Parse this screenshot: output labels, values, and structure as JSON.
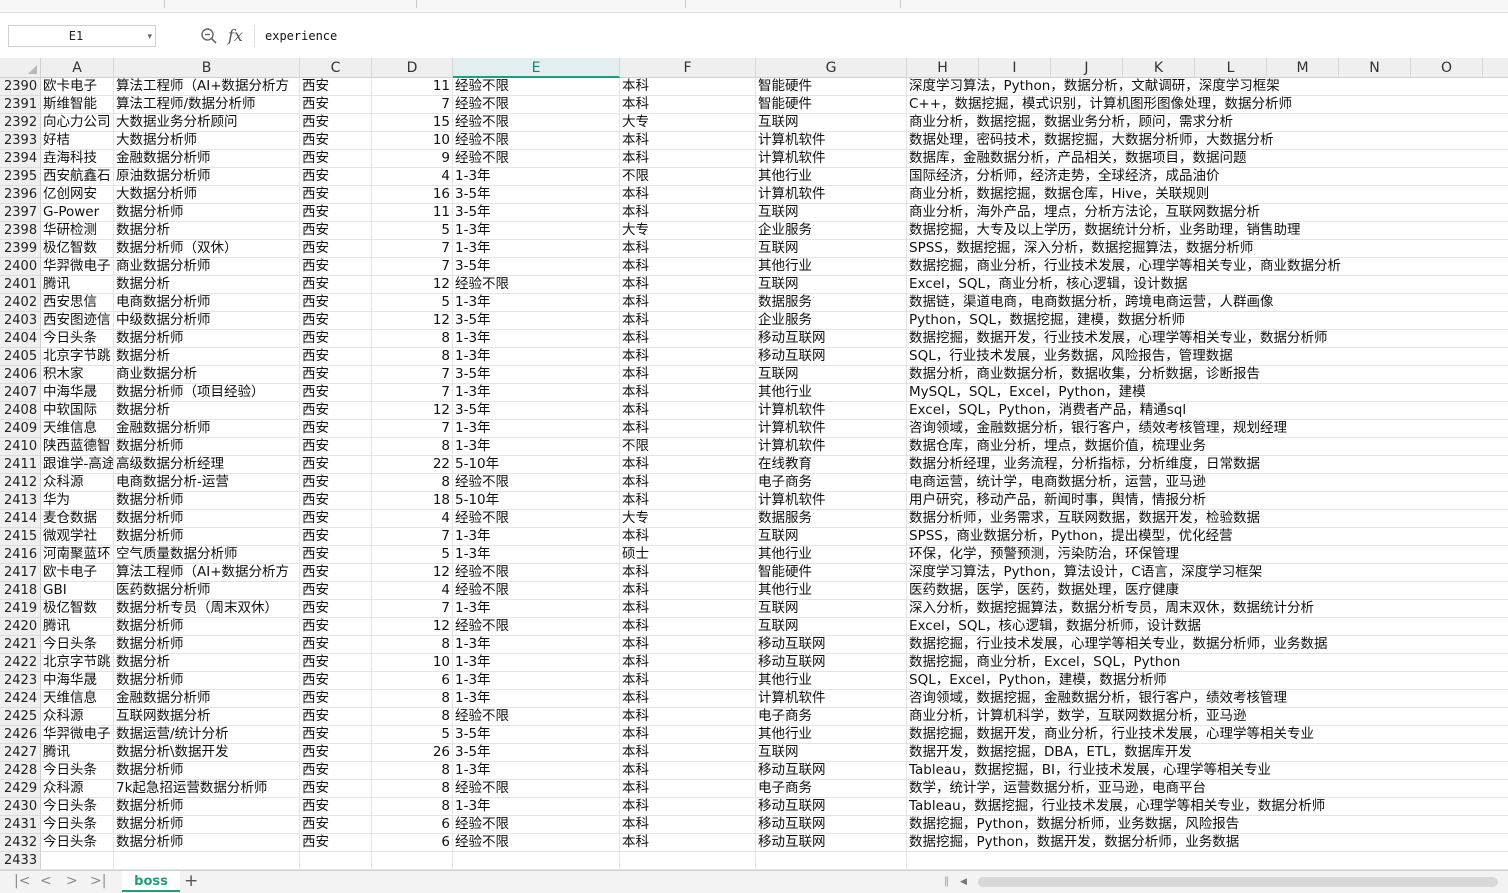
{
  "formula_bar": {
    "name_box": "E1",
    "formula": "experience",
    "fx_label": "fx"
  },
  "columns": [
    "A",
    "B",
    "C",
    "D",
    "E",
    "F",
    "G",
    "H",
    "I",
    "J",
    "K",
    "L",
    "M",
    "N",
    "O"
  ],
  "selected_column": "E",
  "rows": [
    {
      "n": "2390",
      "a": "欧卡电子",
      "b": "算法工程师（AI+数据分析方",
      "c": "西安",
      "d": "11",
      "e": "经验不限",
      "f": "本科",
      "g": "智能硬件",
      "h": "深度学习算法，Python，数据分析，文献调研，深度学习框架"
    },
    {
      "n": "2391",
      "a": "斯维智能",
      "b": "算法工程师/数据分析师",
      "c": "西安",
      "d": "7",
      "e": "经验不限",
      "f": "本科",
      "g": "智能硬件",
      "h": "C++，数据挖掘，模式识别，计算机图形图像处理，数据分析师"
    },
    {
      "n": "2392",
      "a": "向心力公司",
      "b": "大数据业务分析顾问",
      "c": "西安",
      "d": "15",
      "e": "经验不限",
      "f": "大专",
      "g": "互联网",
      "h": "商业分析，数据挖掘，数据业务分析，顾问，需求分析"
    },
    {
      "n": "2393",
      "a": "好桔",
      "b": "大数据分析师",
      "c": "西安",
      "d": "10",
      "e": "经验不限",
      "f": "本科",
      "g": "计算机软件",
      "h": "数据处理，密码技术，数据挖掘，大数据分析师，大数据分析"
    },
    {
      "n": "2394",
      "a": "垚海科技",
      "b": "金融数据分析师",
      "c": "西安",
      "d": "9",
      "e": "经验不限",
      "f": "本科",
      "g": "计算机软件",
      "h": "数据库，金融数据分析，产品相关，数据项目，数据问题"
    },
    {
      "n": "2395",
      "a": "西安航鑫石",
      "b": "原油数据分析师",
      "c": "西安",
      "d": "4",
      "e": "1-3年",
      "f": "不限",
      "g": "其他行业",
      "h": "国际经济，分析师，经济走势，全球经济，成品油价"
    },
    {
      "n": "2396",
      "a": "亿创网安",
      "b": "大数据分析师",
      "c": "西安",
      "d": "16",
      "e": "3-5年",
      "f": "本科",
      "g": "计算机软件",
      "h": "商业分析，数据挖掘，数据仓库，Hive，关联规则"
    },
    {
      "n": "2397",
      "a": "G-Power",
      "b": "数据分析师",
      "c": "西安",
      "d": "11",
      "e": "3-5年",
      "f": "本科",
      "g": "互联网",
      "h": "商业分析，海外产品，埋点，分析方法论，互联网数据分析"
    },
    {
      "n": "2398",
      "a": "华研检测",
      "b": "数据分析",
      "c": "西安",
      "d": "5",
      "e": "1-3年",
      "f": "大专",
      "g": "企业服务",
      "h": "数据挖掘，大专及以上学历，数据统计分析，业务助理，销售助理"
    },
    {
      "n": "2399",
      "a": "极亿智数",
      "b": "数据分析师（双休）",
      "c": "西安",
      "d": "7",
      "e": "1-3年",
      "f": "本科",
      "g": "互联网",
      "h": "SPSS，数据挖掘，深入分析，数据挖掘算法，数据分析师"
    },
    {
      "n": "2400",
      "a": "华羿微电子",
      "b": "商业数据分析师",
      "c": "西安",
      "d": "7",
      "e": "3-5年",
      "f": "本科",
      "g": "其他行业",
      "h": "数据挖掘，商业分析，行业技术发展，心理学等相关专业，商业数据分析"
    },
    {
      "n": "2401",
      "a": "腾讯",
      "b": "数据分析",
      "c": "西安",
      "d": "12",
      "e": "经验不限",
      "f": "本科",
      "g": "互联网",
      "h": "Excel，SQL，商业分析，核心逻辑，设计数据"
    },
    {
      "n": "2402",
      "a": "西安思信",
      "b": "电商数据分析师",
      "c": "西安",
      "d": "5",
      "e": "1-3年",
      "f": "本科",
      "g": "数据服务",
      "h": "数据链，渠道电商，电商数据分析，跨境电商运营，人群画像"
    },
    {
      "n": "2403",
      "a": "西安图迹信",
      "b": "中级数据分析师",
      "c": "西安",
      "d": "12",
      "e": "3-5年",
      "f": "本科",
      "g": "企业服务",
      "h": "Python，SQL，数据挖掘，建模，数据分析师"
    },
    {
      "n": "2404",
      "a": "今日头条",
      "b": "数据分析师",
      "c": "西安",
      "d": "8",
      "e": "1-3年",
      "f": "本科",
      "g": "移动互联网",
      "h": "数据挖掘，数据开发，行业技术发展，心理学等相关专业，数据分析师"
    },
    {
      "n": "2405",
      "a": "北京字节跳",
      "b": "数据分析",
      "c": "西安",
      "d": "8",
      "e": "1-3年",
      "f": "本科",
      "g": "移动互联网",
      "h": "SQL，行业技术发展，业务数据，风险报告，管理数据"
    },
    {
      "n": "2406",
      "a": "积木家",
      "b": "商业数据分析",
      "c": "西安",
      "d": "7",
      "e": "3-5年",
      "f": "本科",
      "g": "互联网",
      "h": "数据分析，商业数据分析，数据收集，分析数据，诊断报告"
    },
    {
      "n": "2407",
      "a": "中海华晟",
      "b": "数据分析师（项目经验）",
      "c": "西安",
      "d": "7",
      "e": "1-3年",
      "f": "本科",
      "g": "其他行业",
      "h": "MySQL，SQL，Excel，Python，建模"
    },
    {
      "n": "2408",
      "a": "中软国际",
      "b": "数据分析",
      "c": "西安",
      "d": "12",
      "e": "3-5年",
      "f": "本科",
      "g": "计算机软件",
      "h": "Excel，SQL，Python，消费者产品，精通sql"
    },
    {
      "n": "2409",
      "a": "天维信息",
      "b": "金融数据分析师",
      "c": "西安",
      "d": "7",
      "e": "1-3年",
      "f": "本科",
      "g": "计算机软件",
      "h": "咨询领域，金融数据分析，银行客户，绩效考核管理，规划经理"
    },
    {
      "n": "2410",
      "a": "陕西蓝德智",
      "b": "数据分析师",
      "c": "西安",
      "d": "8",
      "e": "1-3年",
      "f": "不限",
      "g": "计算机软件",
      "h": "数据仓库，商业分析，埋点，数据价值，梳理业务"
    },
    {
      "n": "2411",
      "a": "跟谁学-高途",
      "b": "高级数据分析经理",
      "c": "西安",
      "d": "22",
      "e": "5-10年",
      "f": "本科",
      "g": "在线教育",
      "h": "数据分析经理，业务流程，分析指标，分析维度，日常数据"
    },
    {
      "n": "2412",
      "a": "众科源",
      "b": "电商数据分析-运营",
      "c": "西安",
      "d": "8",
      "e": "经验不限",
      "f": "本科",
      "g": "电子商务",
      "h": "电商运营，统计学，电商数据分析，运营，亚马逊"
    },
    {
      "n": "2413",
      "a": "华为",
      "b": "数据分析师",
      "c": "西安",
      "d": "18",
      "e": "5-10年",
      "f": "本科",
      "g": "计算机软件",
      "h": "用户研究，移动产品，新闻时事，舆情，情报分析"
    },
    {
      "n": "2414",
      "a": "麦仓数据",
      "b": "数据分析师",
      "c": "西安",
      "d": "4",
      "e": "经验不限",
      "f": "大专",
      "g": "数据服务",
      "h": "数据分析师，业务需求，互联网数据，数据开发，检验数据"
    },
    {
      "n": "2415",
      "a": "微观学社",
      "b": "数据分析师",
      "c": "西安",
      "d": "7",
      "e": "1-3年",
      "f": "本科",
      "g": "互联网",
      "h": "SPSS，商业数据分析，Python，提出模型，优化经营"
    },
    {
      "n": "2416",
      "a": "河南聚蓝环",
      "b": "空气质量数据分析师",
      "c": "西安",
      "d": "5",
      "e": "1-3年",
      "f": "硕士",
      "g": "其他行业",
      "h": "环保，化学，预警预测，污染防治，环保管理"
    },
    {
      "n": "2417",
      "a": "欧卡电子",
      "b": "算法工程师（AI+数据分析方",
      "c": "西安",
      "d": "12",
      "e": "经验不限",
      "f": "本科",
      "g": "智能硬件",
      "h": "深度学习算法，Python，算法设计，C语言，深度学习框架"
    },
    {
      "n": "2418",
      "a": "GBI",
      "b": "医药数据分析师",
      "c": "西安",
      "d": "4",
      "e": "经验不限",
      "f": "本科",
      "g": "其他行业",
      "h": "医药数据，医学，医药，数据处理，医疗健康"
    },
    {
      "n": "2419",
      "a": "极亿智数",
      "b": "数据分析专员（周末双休）",
      "c": "西安",
      "d": "7",
      "e": "1-3年",
      "f": "本科",
      "g": "互联网",
      "h": "深入分析，数据挖掘算法，数据分析专员，周末双休，数据统计分析"
    },
    {
      "n": "2420",
      "a": "腾讯",
      "b": "数据分析师",
      "c": "西安",
      "d": "12",
      "e": "经验不限",
      "f": "本科",
      "g": "互联网",
      "h": "Excel，SQL，核心逻辑，数据分析师，设计数据"
    },
    {
      "n": "2421",
      "a": "今日头条",
      "b": "数据分析师",
      "c": "西安",
      "d": "8",
      "e": "1-3年",
      "f": "本科",
      "g": "移动互联网",
      "h": "数据挖掘，行业技术发展，心理学等相关专业，数据分析师，业务数据"
    },
    {
      "n": "2422",
      "a": "北京字节跳",
      "b": "数据分析",
      "c": "西安",
      "d": "10",
      "e": "1-3年",
      "f": "本科",
      "g": "移动互联网",
      "h": "数据挖掘，商业分析，Excel，SQL，Python"
    },
    {
      "n": "2423",
      "a": "中海华晟",
      "b": "数据分析师",
      "c": "西安",
      "d": "6",
      "e": "1-3年",
      "f": "本科",
      "g": "其他行业",
      "h": "SQL，Excel，Python，建模，数据分析师"
    },
    {
      "n": "2424",
      "a": "天维信息",
      "b": "金融数据分析师",
      "c": "西安",
      "d": "8",
      "e": "1-3年",
      "f": "本科",
      "g": "计算机软件",
      "h": "咨询领域，数据挖掘，金融数据分析，银行客户，绩效考核管理"
    },
    {
      "n": "2425",
      "a": "众科源",
      "b": "互联网数据分析",
      "c": "西安",
      "d": "8",
      "e": "经验不限",
      "f": "本科",
      "g": "电子商务",
      "h": "商业分析，计算机科学，数学，互联网数据分析，亚马逊"
    },
    {
      "n": "2426",
      "a": "华羿微电子",
      "b": "数据运营/统计分析",
      "c": "西安",
      "d": "5",
      "e": "3-5年",
      "f": "本科",
      "g": "其他行业",
      "h": "数据挖掘，数据开发，商业分析，行业技术发展，心理学等相关专业"
    },
    {
      "n": "2427",
      "a": "腾讯",
      "b": "数据分析\\数据开发",
      "c": "西安",
      "d": "26",
      "e": "3-5年",
      "f": "本科",
      "g": "互联网",
      "h": "数据开发，数据挖掘，DBA，ETL，数据库开发"
    },
    {
      "n": "2428",
      "a": "今日头条",
      "b": "数据分析师",
      "c": "西安",
      "d": "8",
      "e": "1-3年",
      "f": "本科",
      "g": "移动互联网",
      "h": "Tableau，数据挖掘，BI，行业技术发展，心理学等相关专业"
    },
    {
      "n": "2429",
      "a": "众科源",
      "b": "7k起急招运营数据分析师",
      "c": "西安",
      "d": "8",
      "e": "经验不限",
      "f": "本科",
      "g": "电子商务",
      "h": "数学，统计学，运营数据分析，亚马逊，电商平台"
    },
    {
      "n": "2430",
      "a": "今日头条",
      "b": "数据分析师",
      "c": "西安",
      "d": "8",
      "e": "1-3年",
      "f": "本科",
      "g": "移动互联网",
      "h": "Tableau，数据挖掘，行业技术发展，心理学等相关专业，数据分析师"
    },
    {
      "n": "2431",
      "a": "今日头条",
      "b": "数据分析师",
      "c": "西安",
      "d": "6",
      "e": "经验不限",
      "f": "本科",
      "g": "移动互联网",
      "h": "数据挖掘，Python，数据分析师，业务数据，风险报告"
    },
    {
      "n": "2432",
      "a": "今日头条",
      "b": "数据分析师",
      "c": "西安",
      "d": "6",
      "e": "经验不限",
      "f": "本科",
      "g": "移动互联网",
      "h": "数据挖掘，Python，数据开发，数据分析师，业务数据"
    },
    {
      "n": "2433",
      "a": "",
      "b": "",
      "c": "",
      "d": "",
      "e": "",
      "f": "",
      "g": "",
      "h": ""
    }
  ],
  "sheet_tabs": [
    "boss"
  ],
  "icons": {
    "nav_first": "|<",
    "nav_prev": "<",
    "nav_next": ">",
    "nav_last": ">|",
    "add_sheet": "+",
    "name_box_dropdown": "▾"
  },
  "colors": {
    "accent": "#1e9e7a",
    "header_bg": "#efefef",
    "selected_header_bg": "#e3eef0"
  }
}
